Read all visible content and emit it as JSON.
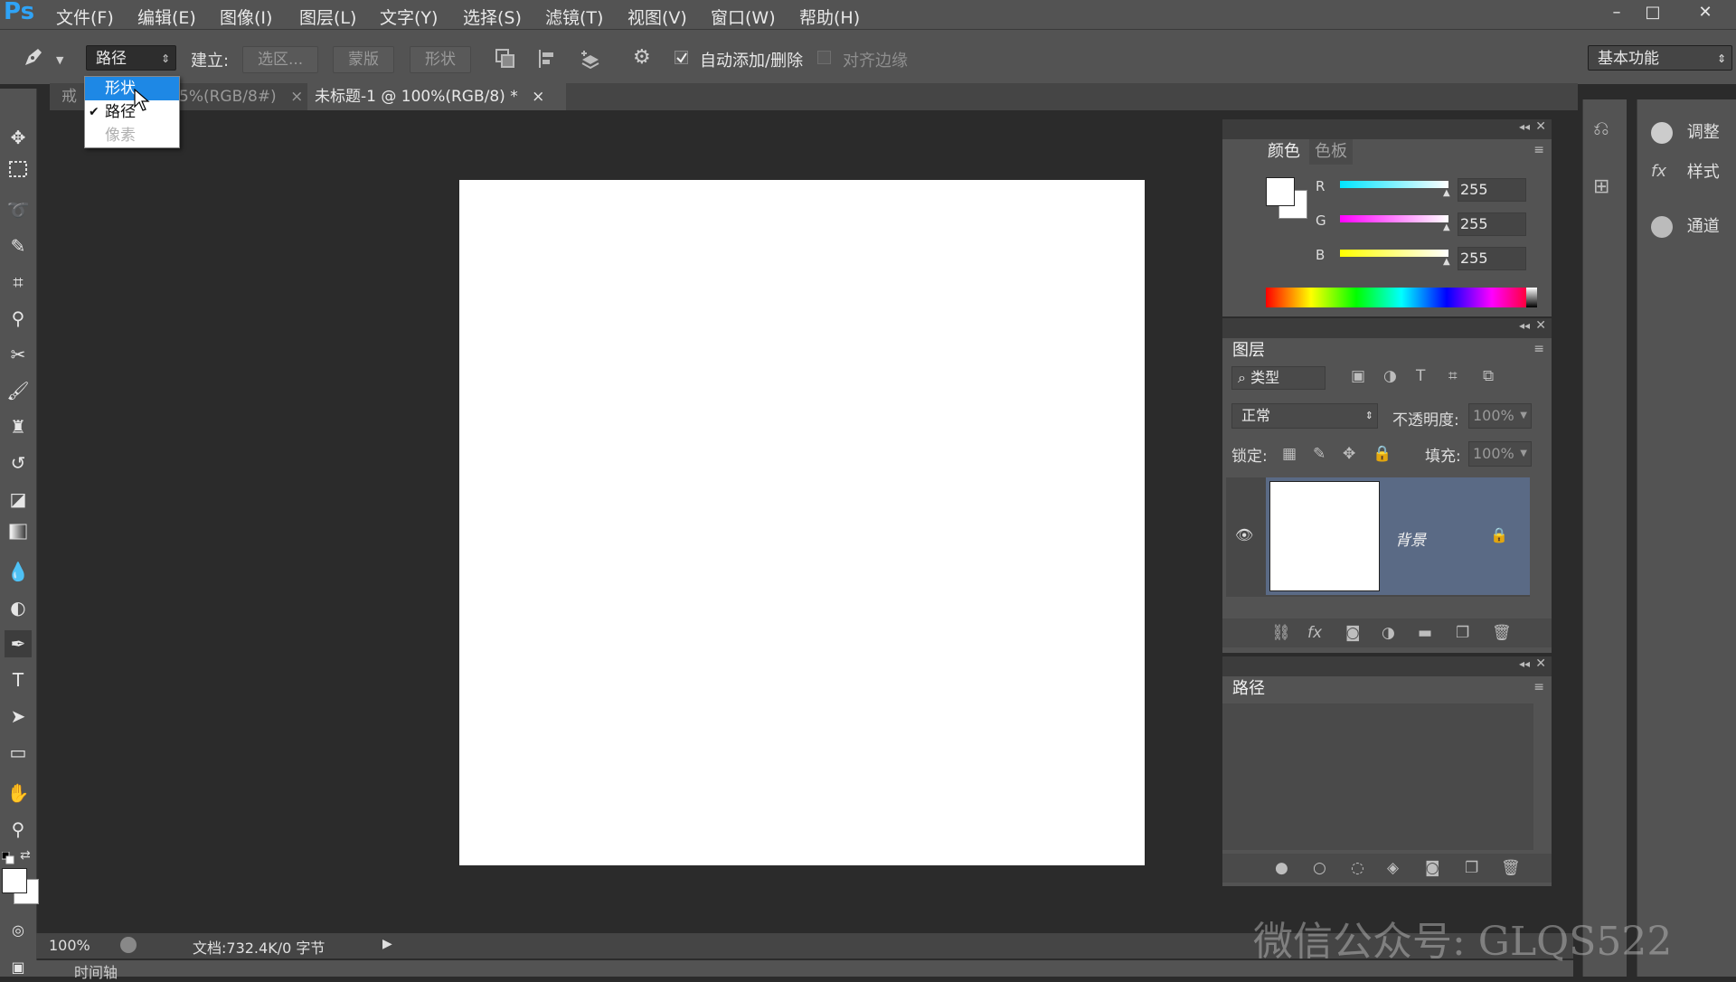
{
  "app": {
    "logo": "Ps"
  },
  "menu": [
    "文件(F)",
    "编辑(E)",
    "图像(I)",
    "图层(L)",
    "文字(Y)",
    "选择(S)",
    "滤镜(T)",
    "视图(V)",
    "窗口(W)",
    "帮助(H)"
  ],
  "window_controls": [
    "–",
    "□",
    "✕"
  ],
  "options": {
    "mode_value": "路径",
    "build_label": "建立:",
    "selection_btn": "选区...",
    "mask_btn": "蒙版",
    "shape_btn": "形状",
    "auto_add_delete": "自动添加/删除",
    "auto_add_delete_checked": true,
    "align_edges": "对齐边缘",
    "align_edges_checked": false,
    "workspace": "基本功能"
  },
  "mode_dropdown": {
    "items": [
      {
        "label": "形状",
        "state": "hover"
      },
      {
        "label": "路径",
        "state": "checked"
      },
      {
        "label": "像素",
        "state": "disabled"
      }
    ]
  },
  "doc_tabs": [
    {
      "label": "戒",
      "partial": true
    },
    {
      "label": "5%(RGB/8#)",
      "close": "×"
    },
    {
      "label": "未标题-1 @ 100%(RGB/8) *",
      "close": "×",
      "active": true
    }
  ],
  "status": {
    "zoom": "100%",
    "doc_info": "文档:732.4K/0 字节",
    "timeline": "时间轴"
  },
  "color_panel": {
    "tabs": [
      "颜色",
      "色板"
    ],
    "channels": [
      {
        "name": "R",
        "value": "255",
        "color": "#00e5ff"
      },
      {
        "name": "G",
        "value": "255",
        "color": "#ff00ff"
      },
      {
        "name": "B",
        "value": "255",
        "color": "#ffff00"
      }
    ]
  },
  "layers_panel": {
    "title": "图层",
    "filter_kind": "类型",
    "blend_mode": "正常",
    "opacity_label": "不透明度:",
    "opacity_value": "100%",
    "lock_label": "锁定:",
    "fill_label": "填充:",
    "fill_value": "100%",
    "layers": [
      {
        "name": "背景",
        "visible": true,
        "locked": true
      }
    ]
  },
  "paths_panel": {
    "title": "路径"
  },
  "right_dock": [
    {
      "label": "调整",
      "icon": "adjustment-icon"
    },
    {
      "label": "样式",
      "icon": "style-icon"
    },
    {
      "label": "通道",
      "icon": "channels-icon"
    }
  ],
  "watermark": "微信公众号: GLQS522",
  "colors": {
    "accent": "#2fa3f6",
    "selected_layer": "#5a6a85"
  }
}
